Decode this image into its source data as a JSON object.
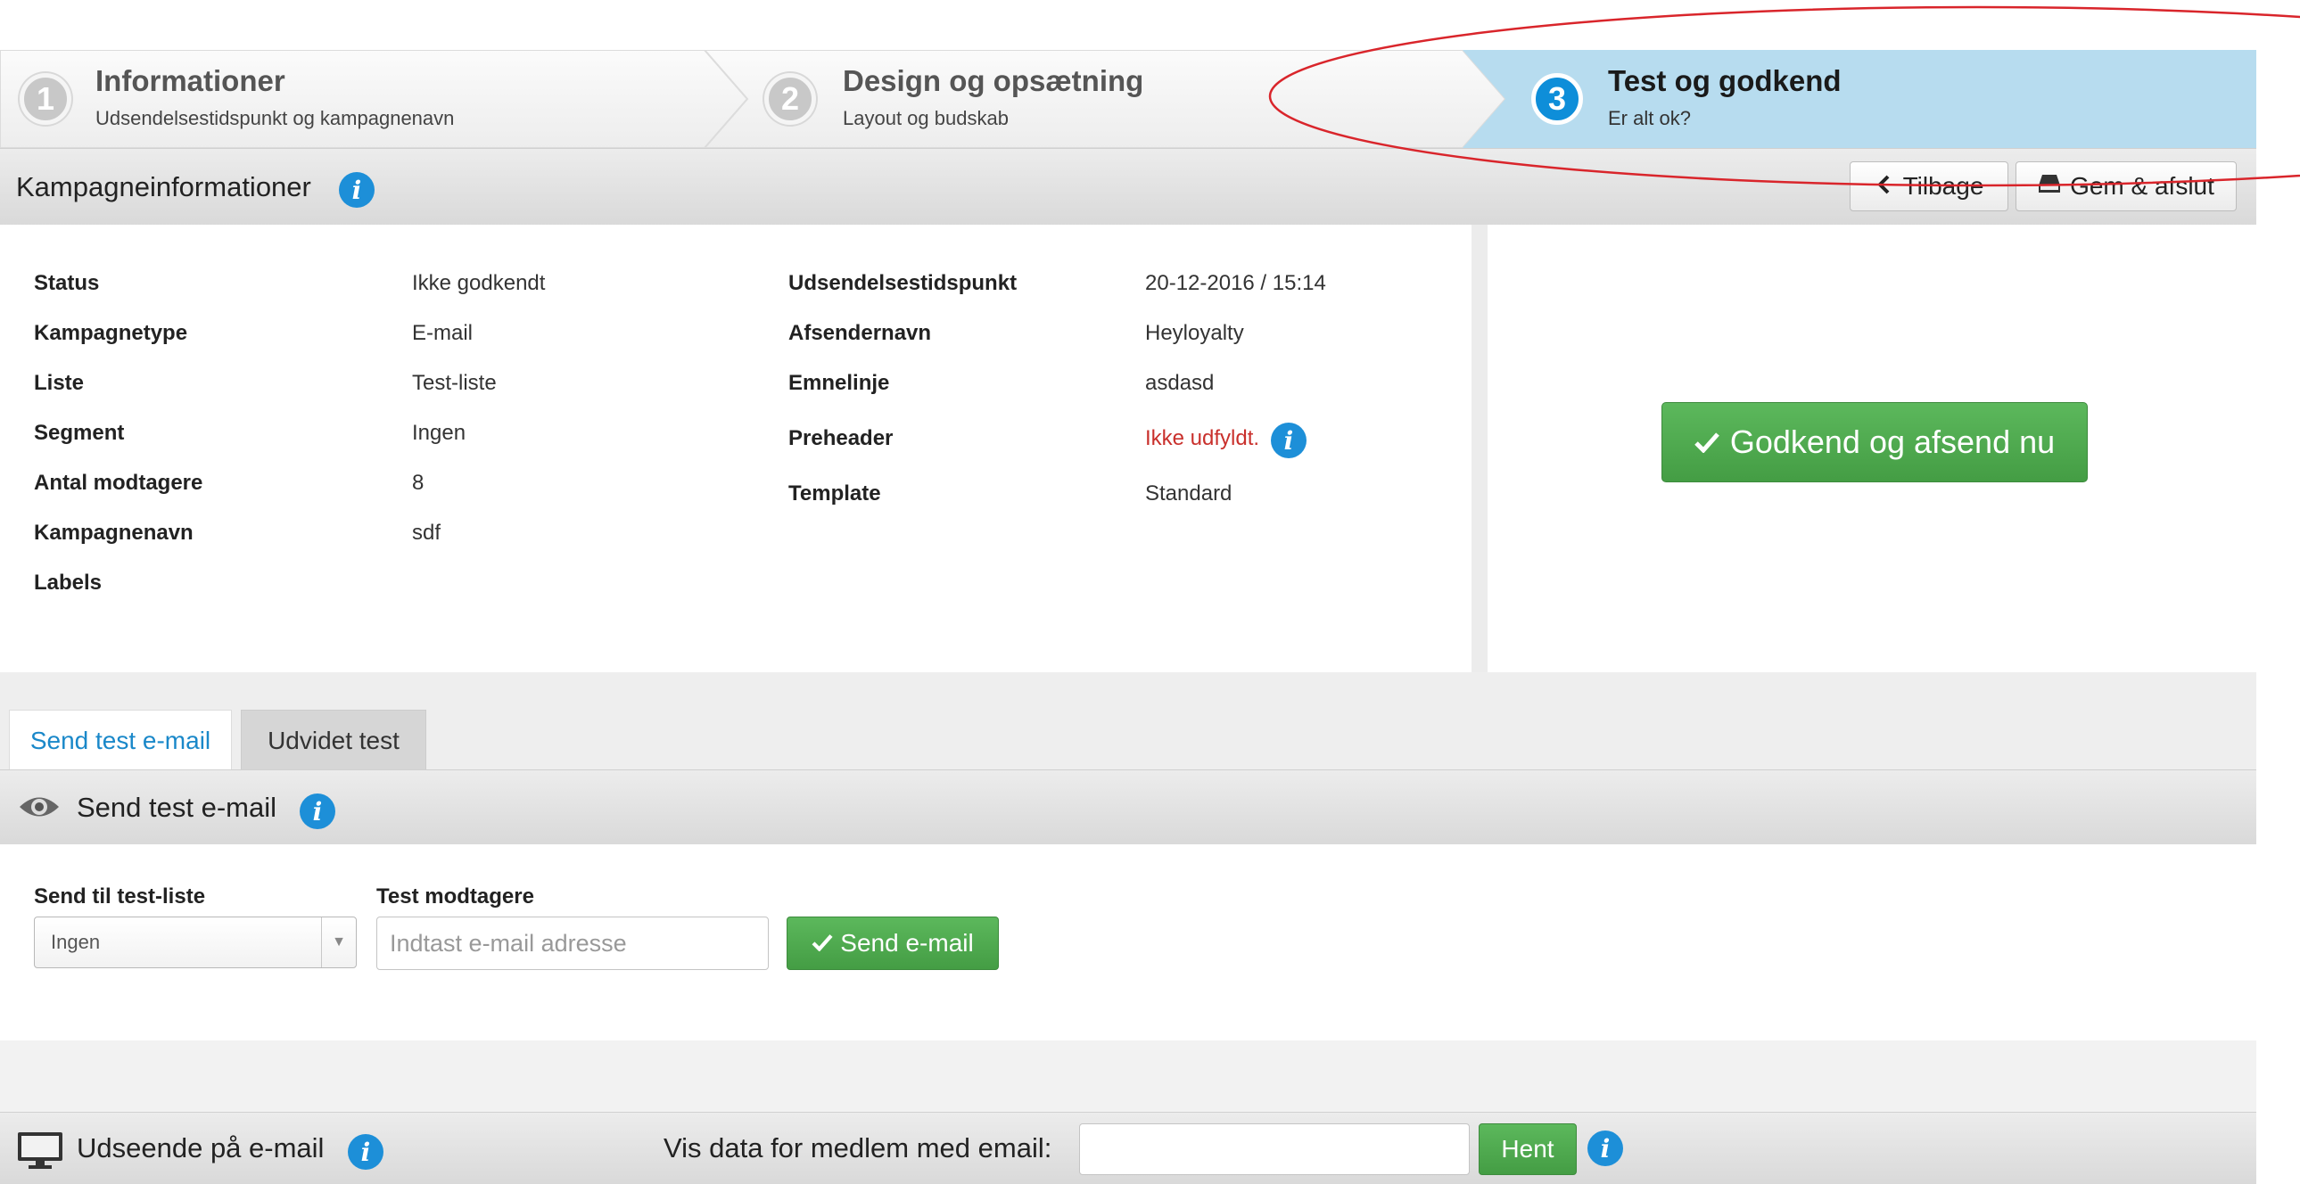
{
  "wizard": {
    "steps": [
      {
        "number": "1",
        "title": "Informationer",
        "subtitle": "Udsendelsestidspunkt og kampagnenavn"
      },
      {
        "number": "2",
        "title": "Design og opsætning",
        "subtitle": "Layout og budskab"
      },
      {
        "number": "3",
        "title": "Test og godkend",
        "subtitle": "Er alt ok?"
      }
    ]
  },
  "campaign_section": {
    "title": "Kampagneinformationer",
    "back_label": "Tilbage",
    "save_label": "Gem & afslut"
  },
  "info_left": [
    {
      "label": "Status",
      "value": "Ikke godkendt"
    },
    {
      "label": "Kampagnetype",
      "value": "E-mail"
    },
    {
      "label": "Liste",
      "value": "Test-liste"
    },
    {
      "label": "Segment",
      "value": "Ingen"
    },
    {
      "label": "Antal modtagere",
      "value": "8"
    },
    {
      "label": "Kampagnenavn",
      "value": "sdf"
    },
    {
      "label": "Labels",
      "value": ""
    }
  ],
  "info_right": [
    {
      "label": "Udsendelsestidspunkt",
      "value": "20-12-2016 / 15:14"
    },
    {
      "label": "Afsendernavn",
      "value": "Heyloyalty"
    },
    {
      "label": "Emnelinje",
      "value": "asdasd"
    },
    {
      "label": "Preheader",
      "value": "Ikke udfyldt."
    },
    {
      "label": "Template",
      "value": "Standard"
    }
  ],
  "approve_button_label": "Godkend og afsend nu",
  "tabs": [
    {
      "label": "Send test e-mail",
      "active": true
    },
    {
      "label": "Udvidet test",
      "active": false
    }
  ],
  "test_section": {
    "title": "Send test e-mail",
    "list_label": "Send til test-liste",
    "list_selected": "Ingen",
    "recipients_label": "Test modtagere",
    "recipients_placeholder": "Indtast e-mail adresse",
    "send_label": "Send e-mail"
  },
  "appearance_section": {
    "title": "Udseende på e-mail",
    "member_label": "Vis data for medlem med email:",
    "member_value": "",
    "fetch_label": "Hent"
  },
  "colors": {
    "accent_blue": "#0e8ed9",
    "active_step_bg": "#b7dcef",
    "success_green": "#5cb85c",
    "warning_red": "#c9302c",
    "annotation_red": "#d9252b"
  },
  "icons": {
    "info": "info-icon",
    "back": "chevron-left-icon",
    "save": "inbox-tray-icon",
    "check": "check-icon",
    "eye": "eye-icon",
    "monitor": "monitor-icon",
    "dropdown": "caret-down-icon"
  }
}
